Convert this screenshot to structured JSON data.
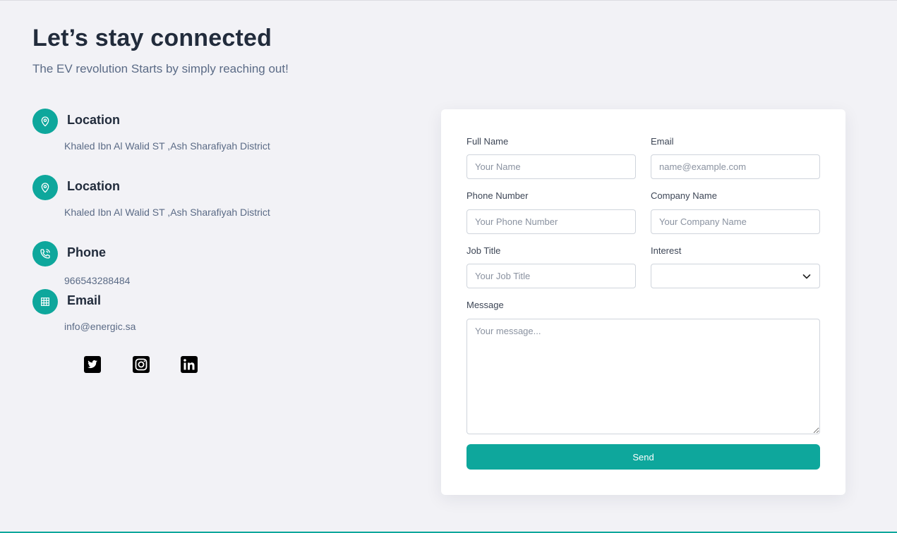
{
  "header": {
    "title": "Let’s stay connected",
    "subtitle": "The EV revolution Starts by simply reaching out!"
  },
  "contacts": [
    {
      "icon": "location-pin-icon",
      "heading": "Location",
      "detail": "Khaled Ibn Al Walid ST ,Ash Sharafiyah District"
    },
    {
      "icon": "location-pin-icon",
      "heading": "Location",
      "detail": "Khaled Ibn Al Walid ST ,Ash Sharafiyah District"
    },
    {
      "icon": "phone-icon",
      "heading": "Phone",
      "detail": "966543288484"
    },
    {
      "icon": "building-icon",
      "heading": "Email",
      "detail": "info@energic.sa"
    }
  ],
  "social": [
    {
      "icon": "twitter-icon"
    },
    {
      "icon": "instagram-icon"
    },
    {
      "icon": "linkedin-icon"
    }
  ],
  "form": {
    "full_name": {
      "label": "Full Name",
      "placeholder": "Your Name",
      "value": ""
    },
    "email": {
      "label": "Email",
      "placeholder": "name@example.com",
      "value": ""
    },
    "phone": {
      "label": "Phone Number",
      "placeholder": "Your Phone Number",
      "value": ""
    },
    "company": {
      "label": "Company Name",
      "placeholder": "Your Company Name",
      "value": ""
    },
    "job_title": {
      "label": "Job Title",
      "placeholder": "Your Job Title",
      "value": ""
    },
    "interest": {
      "label": "Interest",
      "selected": ""
    },
    "message": {
      "label": "Message",
      "placeholder": "Your message...",
      "value": ""
    },
    "send_label": "Send"
  },
  "colors": {
    "accent": "#0ea79c",
    "background": "#f2f2f6",
    "heading": "#222c3c",
    "muted_text": "#5b6b86"
  }
}
